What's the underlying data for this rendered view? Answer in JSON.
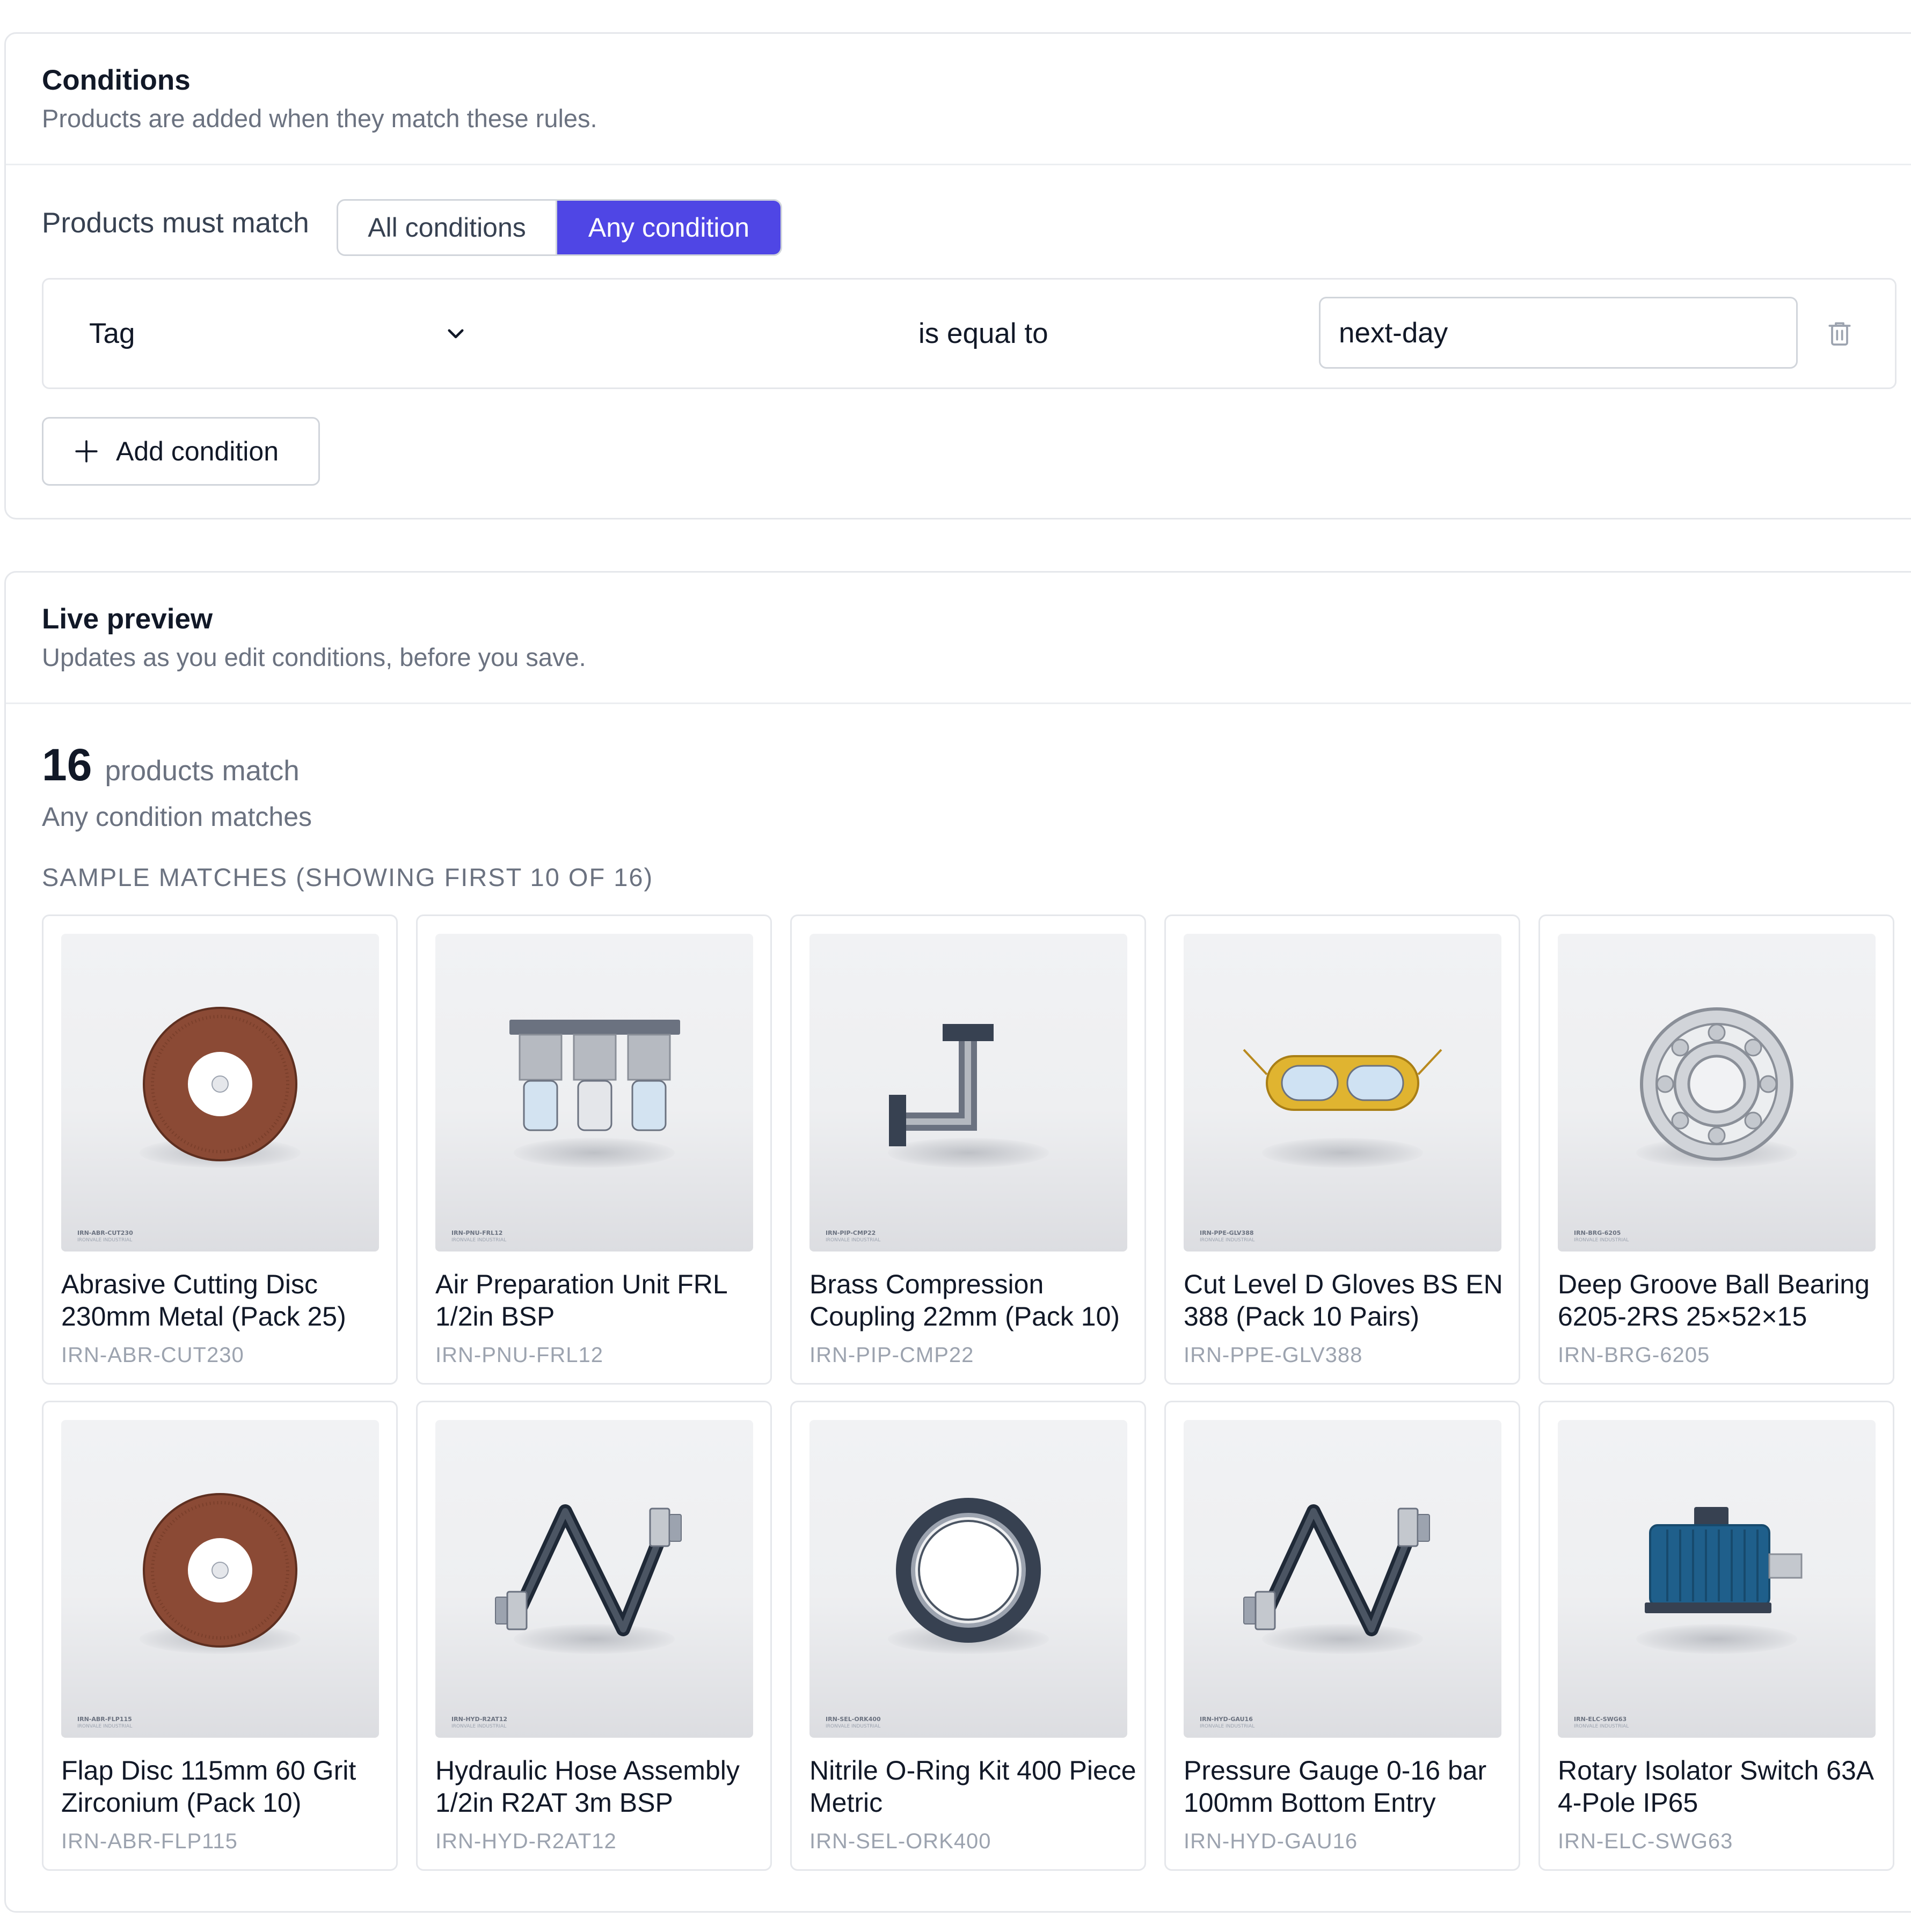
{
  "conditions": {
    "title": "Conditions",
    "subtitle": "Products are added when they match these rules.",
    "match_label": "Products must match",
    "match_options": [
      "All conditions",
      "Any condition"
    ],
    "match_selected": "Any condition",
    "rule": {
      "field": "Tag",
      "operator": "is equal to",
      "value": "next-day"
    },
    "add_condition_label": "Add condition",
    "accent_color": "#4f46e5"
  },
  "preview": {
    "title": "Live preview",
    "subtitle": "Updates as you edit conditions, before you save.",
    "count": "16",
    "count_label": "products match",
    "match_mode_text": "Any condition matches",
    "sample_heading": "SAMPLE MATCHES (SHOWING FIRST 10 OF 16)",
    "watermark_brand": "IRONVALE INDUSTRIAL",
    "products": [
      {
        "name": "Abrasive Cutting Disc 230mm Metal (Pack 25)",
        "sku": "IRN-ABR-CUT230",
        "icon": "cutting-disc-icon"
      },
      {
        "name": "Air Preparation Unit FRL 1/2in BSP",
        "sku": "IRN-PNU-FRL12",
        "icon": "frl-unit-icon"
      },
      {
        "name": "Brass Compression Coupling 22mm (Pack 10)",
        "sku": "IRN-PIP-CMP22",
        "icon": "pipe-coupling-icon"
      },
      {
        "name": "Cut Level D Gloves BS EN 388 (Pack 10 Pairs)",
        "sku": "IRN-PPE-GLV388",
        "icon": "safety-goggles-icon"
      },
      {
        "name": "Deep Groove Ball Bearing 6205-2RS 25×52×15",
        "sku": "IRN-BRG-6205",
        "icon": "ball-bearing-icon"
      },
      {
        "name": "Flap Disc 115mm 60 Grit Zirconium (Pack 10)",
        "sku": "IRN-ABR-FLP115",
        "icon": "flap-disc-icon"
      },
      {
        "name": "Hydraulic Hose Assembly 1/2in R2AT 3m BSP",
        "sku": "IRN-HYD-R2AT12",
        "icon": "hydraulic-hose-icon"
      },
      {
        "name": "Nitrile O-Ring Kit 400 Piece Metric",
        "sku": "IRN-SEL-ORK400",
        "icon": "o-ring-icon"
      },
      {
        "name": "Pressure Gauge 0-16 bar 100mm Bottom Entry",
        "sku": "IRN-HYD-GAU16",
        "icon": "hose-gauge-icon"
      },
      {
        "name": "Rotary Isolator Switch 63A 4-Pole IP65",
        "sku": "IRN-ELC-SWG63",
        "icon": "electric-motor-icon"
      }
    ]
  }
}
